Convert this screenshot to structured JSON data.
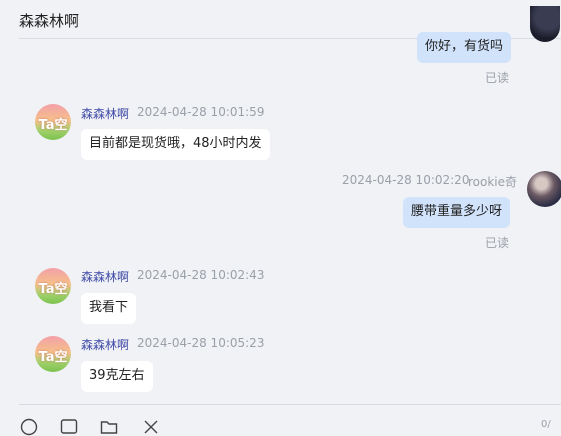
{
  "header": {
    "title": "森森林啊"
  },
  "messages": [
    {
      "from": "me",
      "text": "你好，有货吗",
      "status": "已读"
    },
    {
      "from": "them",
      "sender": "森森林啊",
      "time": "2024-04-28 10:01:59",
      "text": "目前都是现货哦，48小时内发"
    },
    {
      "from": "me",
      "sender": "rookie奇",
      "time": "2024-04-28 10:02:20",
      "text": "腰带重量多少呀",
      "status": "已读"
    },
    {
      "from": "them",
      "sender": "森森林啊",
      "time": "2024-04-28 10:02:43",
      "text": "我看下"
    },
    {
      "from": "them",
      "sender": "森森林啊",
      "time": "2024-04-28 10:05:23",
      "text": "39克左右"
    }
  ],
  "avatar": {
    "ta_text": "Ta空"
  },
  "composer": {
    "counter": "0/"
  },
  "icons": [
    "emoji-icon",
    "image-icon",
    "folder-icon",
    "scissors-icon"
  ]
}
